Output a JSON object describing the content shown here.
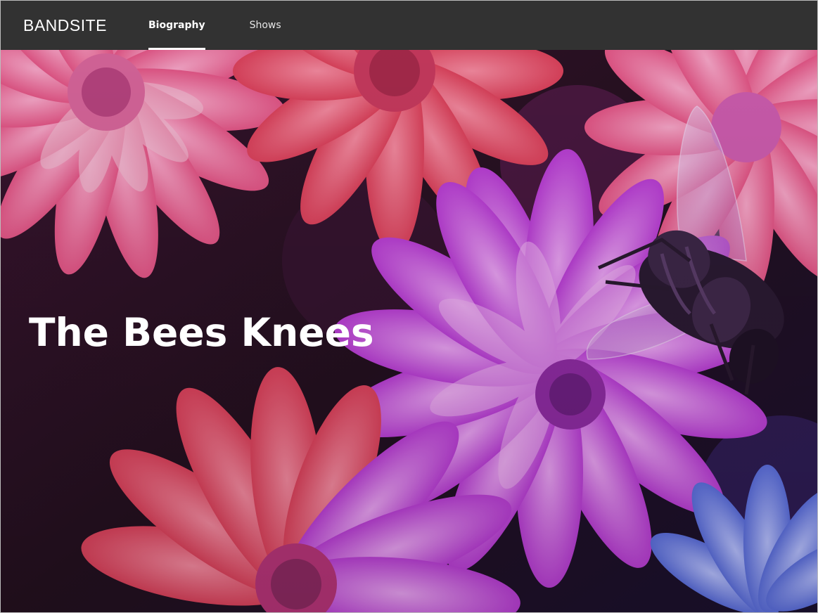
{
  "header": {
    "logo": "BANDSITE",
    "nav": [
      {
        "label": "Biography",
        "active": true
      },
      {
        "label": "Shows",
        "active": false
      }
    ]
  },
  "hero": {
    "title": "The Bees Knees",
    "image": "flowers-and-bee-photo"
  },
  "colors": {
    "header_bg": "#323232",
    "hero_tint_pink": "#e0467a",
    "hero_tint_purple": "#b12bd0",
    "hero_tint_blue": "#4a5fd8"
  }
}
